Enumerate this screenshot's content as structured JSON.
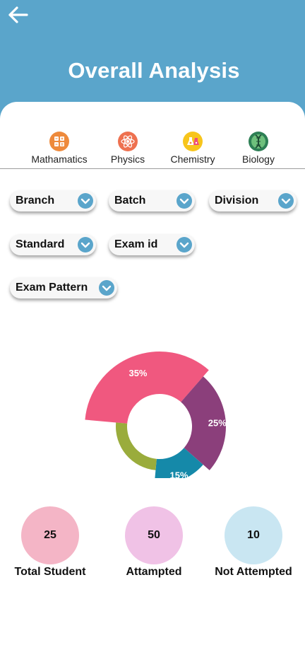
{
  "header": {
    "title": "Overall Analysis",
    "background": "#5aa5cb"
  },
  "subjects": [
    {
      "label": "Mathamatics",
      "icon": "calculator-icon",
      "color": "#ee8a3c"
    },
    {
      "label": "Physics",
      "icon": "atom-icon",
      "color": "#ee7150"
    },
    {
      "label": "Chemistry",
      "icon": "chemistry-flask-icon",
      "color": "#f7c51c"
    },
    {
      "label": "Biology",
      "icon": "dna-icon",
      "color": "#2d7f55"
    }
  ],
  "filters": {
    "branch": "Branch",
    "batch": "Batch",
    "division": "Division",
    "standard": "Standard",
    "exam_id": "Exam id",
    "exam_pattern": "Exam Pattern",
    "chevron_color": "#5aa5cb"
  },
  "chart_data": {
    "type": "pie",
    "slices": [
      {
        "value": 35,
        "label": "35%",
        "color": "#f0587f"
      },
      {
        "value": 25,
        "label": "25%",
        "color": "#8b3f7b"
      },
      {
        "value": 15,
        "label": "15%",
        "color": "#1589a9"
      },
      {
        "value": 25,
        "label": "",
        "color": "#9aac3c"
      }
    ]
  },
  "stats": [
    {
      "value": "25",
      "label": "Total Student",
      "color": "#f4b5c6"
    },
    {
      "value": "50",
      "label": "Attampted",
      "color": "#f0c2e6"
    },
    {
      "value": "10",
      "label": "Not Attempted",
      "color": "#c9e6f2"
    }
  ]
}
